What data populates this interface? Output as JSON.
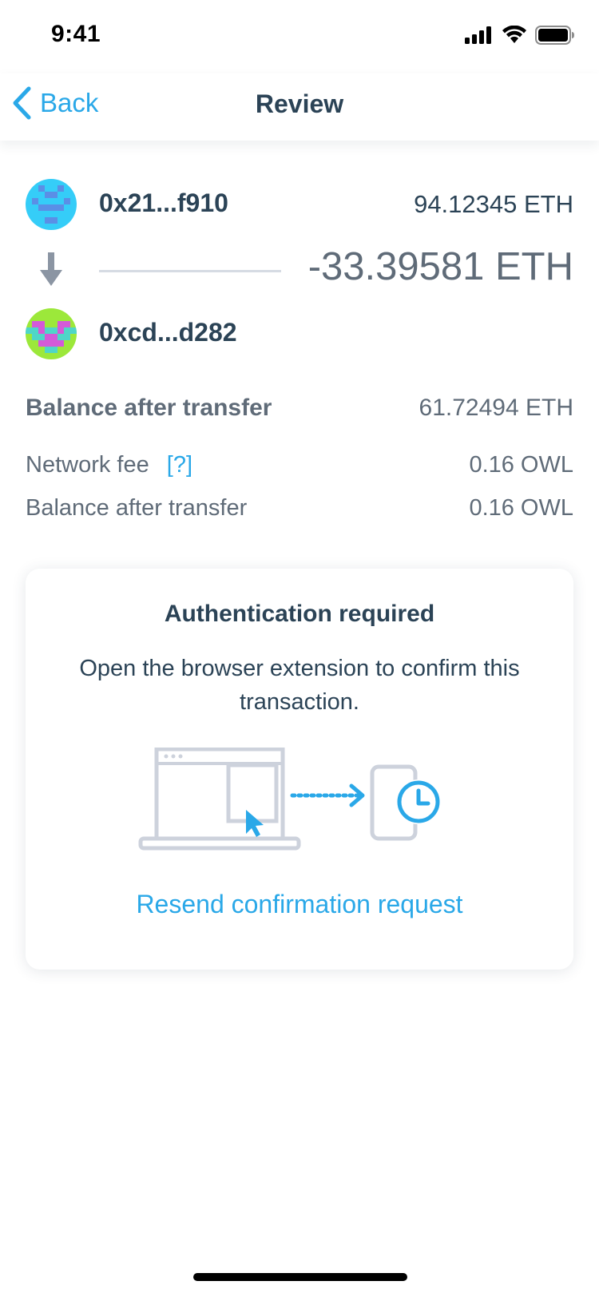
{
  "status_bar": {
    "time": "9:41"
  },
  "nav": {
    "back_label": "Back",
    "title": "Review"
  },
  "transfer": {
    "from": {
      "address": "0x21...f910",
      "balance": "94.12345 ETH",
      "avatar_icon": "identicon-blue"
    },
    "amount": "-33.39581 ETH",
    "to": {
      "address": "0xcd...d282",
      "avatar_icon": "identicon-green-magenta"
    },
    "arrow_icon": "arrow-down-icon"
  },
  "summary": {
    "balance_after_label": "Balance after transfer",
    "balance_after_value": "61.72494 ETH",
    "network_fee_label": "Network fee",
    "network_fee_help": "[?]",
    "network_fee_value": "0.16 OWL",
    "balance_after_fee_label": "Balance after transfer",
    "balance_after_fee_value": "0.16 OWL"
  },
  "auth_card": {
    "title": "Authentication required",
    "body": "Open the browser extension to confirm this transaction.",
    "illustration_icons": [
      "laptop-icon",
      "cursor-icon",
      "dotted-arrow-icon",
      "phone-icon",
      "clock-icon"
    ],
    "resend_label": "Resend confirmation request"
  },
  "colors": {
    "accent": "#2aa8e8",
    "text": "#2b4356",
    "muted": "#5f6b78",
    "line": "#d6dbe3"
  }
}
